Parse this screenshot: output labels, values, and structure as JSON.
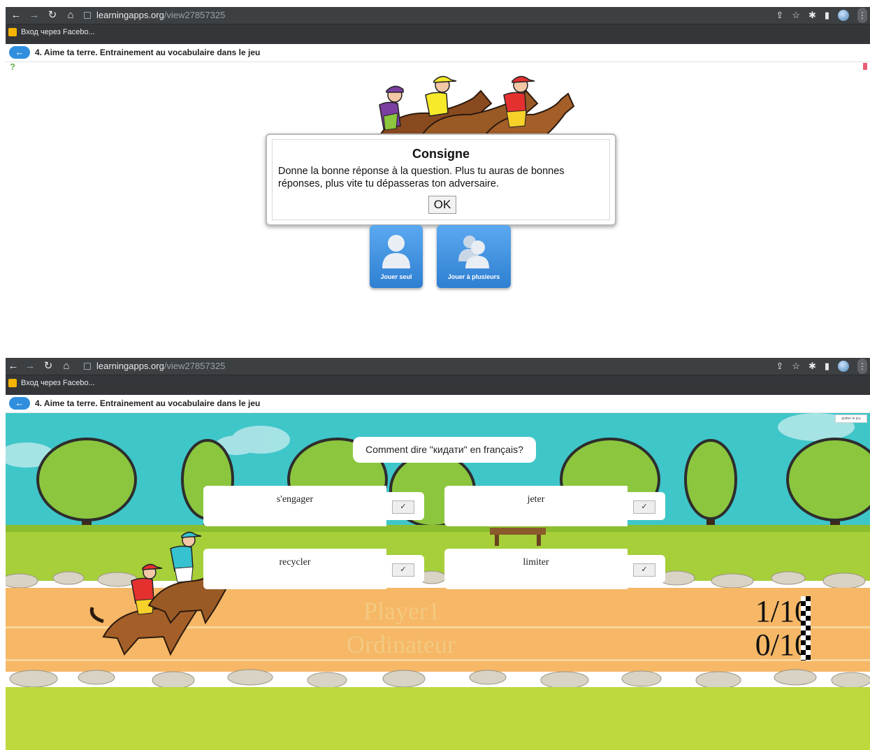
{
  "browser": {
    "url_host": "learningapps.org",
    "url_path": "/view27857325",
    "bookmark_label": "Вход через Facebo..."
  },
  "page": {
    "title": "4. Aime ta terre. Entrainement au vocabulaire dans le jeu"
  },
  "start_screen": {
    "dialog_title": "Consigne",
    "dialog_text": "Donne la bonne réponse à la question. Plus tu auras de bonnes réponses, plus vite tu dépasseras ton adversaire.",
    "ok_label": "OK",
    "play_alone_label": "Jouer seul",
    "play_multi_label": "Jouer à plusieurs"
  },
  "game": {
    "quit_label": "quitter le jeu",
    "question": "Comment dire \"кидати\" en français?",
    "answers": [
      "s'engager",
      "jeter",
      "recycler",
      "limiter"
    ],
    "check_symbol": "✓",
    "player_label": "Player1",
    "computer_label": "Ordinateur",
    "player_score": "1/10",
    "computer_score": "0/10"
  },
  "colors": {
    "chrome_bar": "#3c4043",
    "accent_blue": "#2f8fde",
    "sky": "#3fc6c9",
    "grass": "#a6cf3a",
    "track": "#f6b766"
  }
}
